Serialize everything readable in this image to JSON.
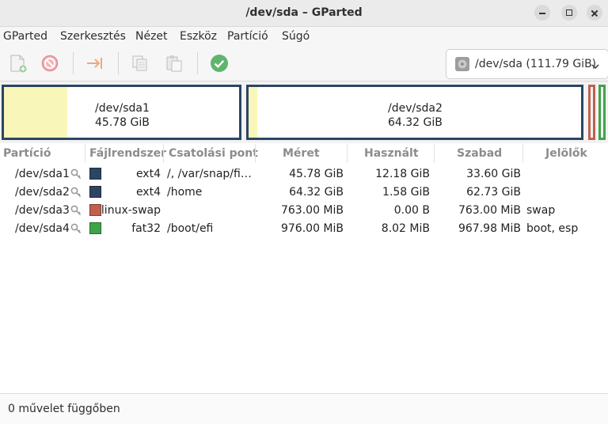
{
  "window": {
    "title": "/dev/sda – GParted"
  },
  "menu": [
    "GParted",
    "Szerkesztés",
    "Nézet",
    "Eszköz",
    "Partíció",
    "Súgó"
  ],
  "toolbar": {
    "icons": [
      "new-partition-icon",
      "delete-icon",
      "resize-move-icon",
      "copy-icon",
      "paste-icon",
      "apply-icon"
    ],
    "device_selector": "/dev/sda  (111.79 GiB)"
  },
  "graph": {
    "partitions": [
      {
        "name": "/dev/sda1",
        "size": "45.78 GiB",
        "used_fraction": 0.27,
        "border_color": "#2b4563"
      },
      {
        "name": "/dev/sda2",
        "size": "64.32 GiB",
        "used_fraction": 0.025,
        "border_color": "#2b4563"
      }
    ],
    "small_partitions_colors": [
      "#c0604f",
      "#3fa34a"
    ]
  },
  "table": {
    "headers": [
      "Partíció",
      "Fájlrendszer",
      "Csatolási pont",
      "Méret",
      "Használt",
      "Szabad",
      "Jelölők"
    ],
    "rows": [
      {
        "partition": "/dev/sda1",
        "fs": "ext4",
        "fs_color": "#2b4563",
        "mount": "/, /var/snap/fi…",
        "size": "45.78 GiB",
        "used": "12.18 GiB",
        "free": "33.60 GiB",
        "flags": ""
      },
      {
        "partition": "/dev/sda2",
        "fs": "ext4",
        "fs_color": "#2b4563",
        "mount": "/home",
        "size": "64.32 GiB",
        "used": "1.58 GiB",
        "free": "62.73 GiB",
        "flags": ""
      },
      {
        "partition": "/dev/sda3",
        "fs": "linux-swap",
        "fs_color": "#c0604f",
        "mount": "",
        "size": "763.00 MiB",
        "used": "0.00 B",
        "free": "763.00 MiB",
        "flags": "swap"
      },
      {
        "partition": "/dev/sda4",
        "fs": "fat32",
        "fs_color": "#3fa34a",
        "mount": "/boot/efi",
        "size": "976.00 MiB",
        "used": "8.02 MiB",
        "free": "967.98 MiB",
        "flags": "boot, esp"
      }
    ]
  },
  "status": {
    "text": "0 művelet függőben"
  }
}
